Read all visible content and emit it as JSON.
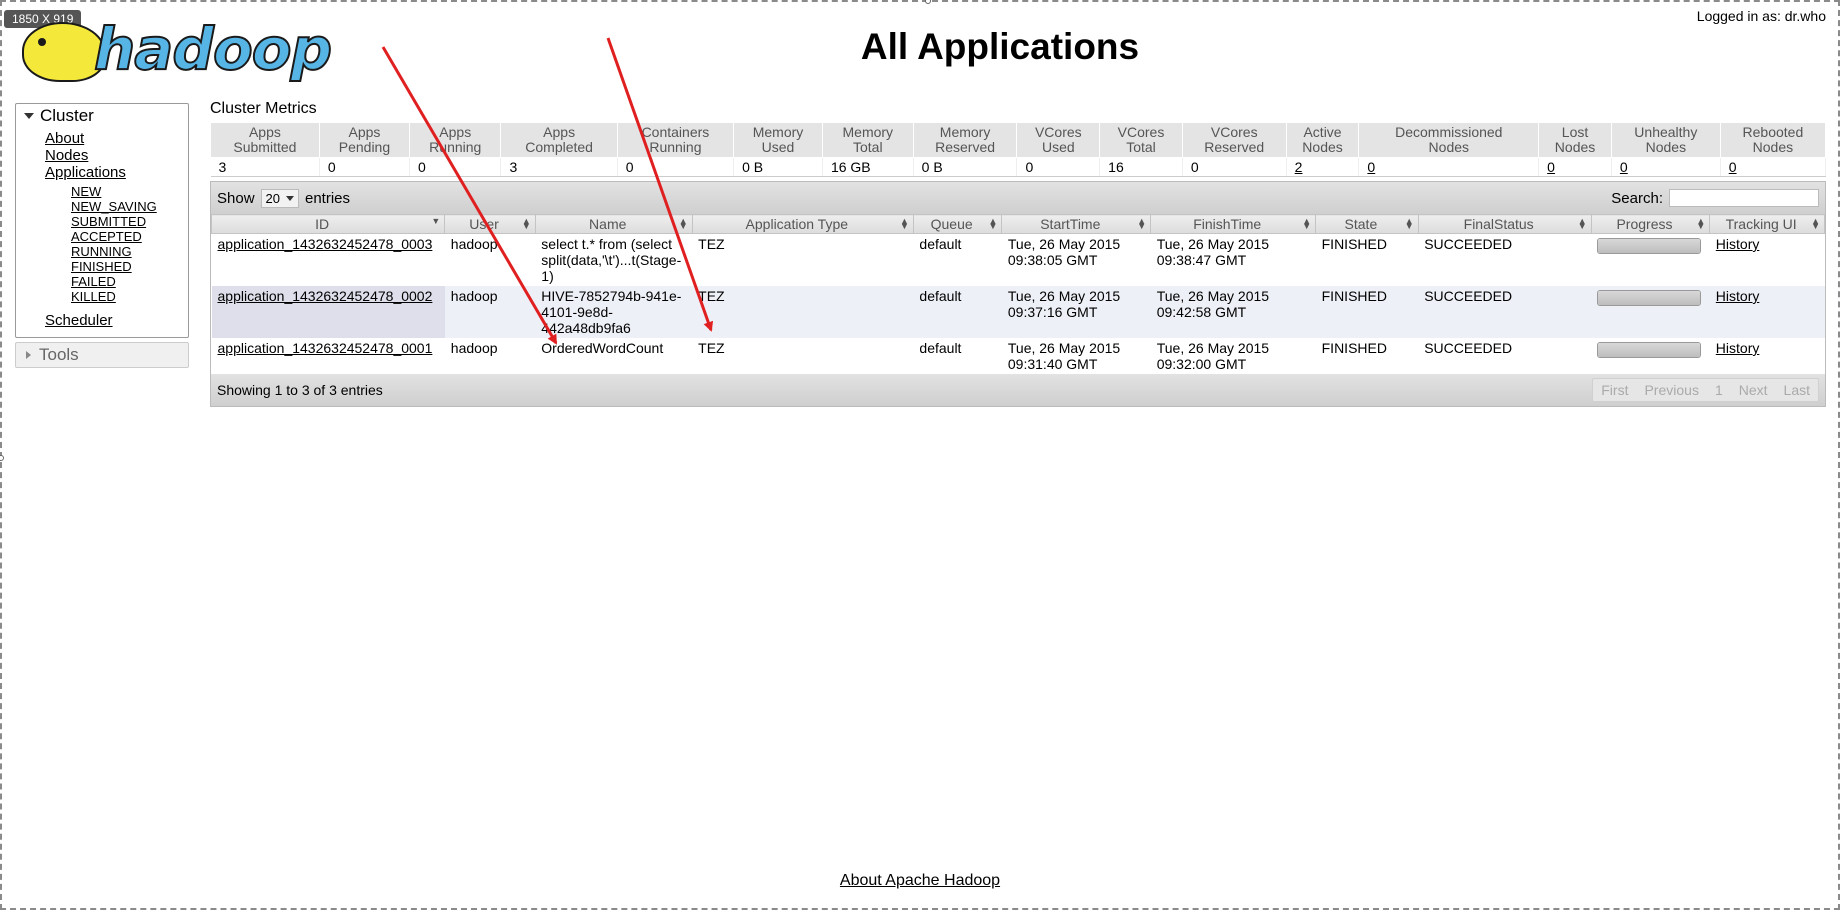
{
  "badge": {
    "dimensions": "1850 X 919"
  },
  "header": {
    "logo_text": "hadoop",
    "title": "All Applications",
    "logged_in": "Logged in as: dr.who"
  },
  "sidebar": {
    "cluster_label": "Cluster",
    "links": [
      "About",
      "Nodes",
      "Applications"
    ],
    "app_states": [
      "NEW",
      "NEW_SAVING",
      "SUBMITTED",
      "ACCEPTED",
      "RUNNING",
      "FINISHED",
      "FAILED",
      "KILLED"
    ],
    "scheduler_label": "Scheduler",
    "tools_label": "Tools"
  },
  "metrics": {
    "title": "Cluster Metrics",
    "headers": [
      [
        "Apps",
        "Submitted"
      ],
      [
        "Apps",
        "Pending"
      ],
      [
        "Apps",
        "Running"
      ],
      [
        "Apps",
        "Completed"
      ],
      [
        "Containers",
        "Running"
      ],
      [
        "Memory",
        "Used"
      ],
      [
        "Memory",
        "Total"
      ],
      [
        "Memory",
        "Reserved"
      ],
      [
        "VCores",
        "Used"
      ],
      [
        "VCores",
        "Total"
      ],
      [
        "VCores",
        "Reserved"
      ],
      [
        "Active",
        "Nodes"
      ],
      [
        "Decommissioned",
        "Nodes"
      ],
      [
        "Lost",
        "Nodes"
      ],
      [
        "Unhealthy",
        "Nodes"
      ],
      [
        "Rebooted",
        "Nodes"
      ]
    ],
    "values": [
      "3",
      "0",
      "0",
      "3",
      "0",
      "0 B",
      "16 GB",
      "0 B",
      "0",
      "16",
      "0",
      "2",
      "0",
      "0",
      "0",
      "0"
    ]
  },
  "apps_table": {
    "show_label": "Show",
    "entries_value": "20",
    "entries_label": "entries",
    "search_label": "Search:",
    "columns": [
      "ID",
      "User",
      "Name",
      "Application Type",
      "Queue",
      "StartTime",
      "FinishTime",
      "State",
      "FinalStatus",
      "Progress",
      "Tracking UI"
    ],
    "rows": [
      {
        "id": "application_1432632452478_0003",
        "user": "hadoop",
        "name": "select t.* from (select split(data,'\\t')...t(Stage-1)",
        "type": "TEZ",
        "queue": "default",
        "start": "Tue, 26 May 2015 09:38:05 GMT",
        "finish": "Tue, 26 May 2015 09:38:47 GMT",
        "state": "FINISHED",
        "final_status": "SUCCEEDED",
        "progress": 1.0,
        "tracking": "History"
      },
      {
        "id": "application_1432632452478_0002",
        "user": "hadoop",
        "name": "HIVE-7852794b-941e-4101-9e8d-442a48db9fa6",
        "type": "TEZ",
        "queue": "default",
        "start": "Tue, 26 May 2015 09:37:16 GMT",
        "finish": "Tue, 26 May 2015 09:42:58 GMT",
        "state": "FINISHED",
        "final_status": "SUCCEEDED",
        "progress": 1.0,
        "tracking": "History"
      },
      {
        "id": "application_1432632452478_0001",
        "user": "hadoop",
        "name": "OrderedWordCount",
        "type": "TEZ",
        "queue": "default",
        "start": "Tue, 26 May 2015 09:31:40 GMT",
        "finish": "Tue, 26 May 2015 09:32:00 GMT",
        "state": "FINISHED",
        "final_status": "SUCCEEDED",
        "progress": 1.0,
        "tracking": "History"
      }
    ],
    "info": "Showing 1 to 3 of 3 entries",
    "pager": [
      "First",
      "Previous",
      "1",
      "Next",
      "Last"
    ]
  },
  "footer": {
    "about_link": "About Apache Hadoop"
  },
  "annotation": {
    "arrow_color": "#e02020"
  }
}
